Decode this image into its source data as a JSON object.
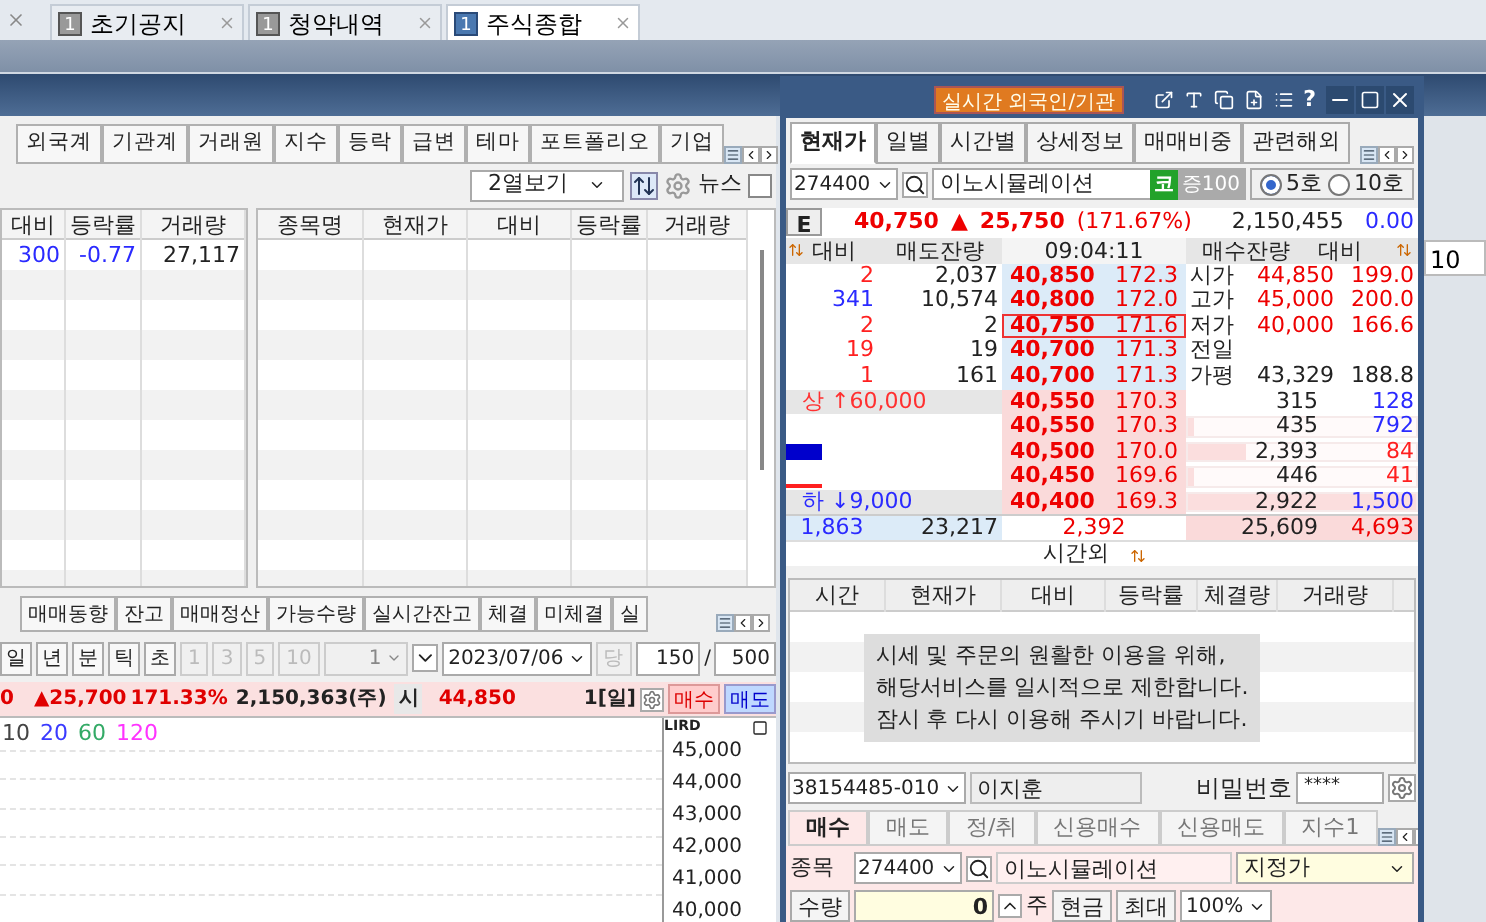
{
  "top_tabs": [
    {
      "badge": "1",
      "label": "초기공지",
      "selected": false
    },
    {
      "badge": "1",
      "label": "청약내역",
      "selected": false
    },
    {
      "badge": "1",
      "label": "주식종합",
      "selected": true
    }
  ],
  "left_window": {
    "tabs": [
      "외국계",
      "기관계",
      "거래원",
      "지수",
      "등락",
      "급변",
      "테마",
      "포트폴리오",
      "기업"
    ],
    "view_select": "2열보기",
    "news_label": "뉴스",
    "news_checked": false,
    "table_a": {
      "columns": [
        "대비",
        "등락률",
        "거래량"
      ],
      "rows": [
        {
          "cells": [
            "300",
            "-0.77",
            "27,117"
          ],
          "color": "#2a2aff"
        }
      ]
    },
    "table_b": {
      "columns": [
        "종목명",
        "현재가",
        "대비",
        "등락률",
        "거래량"
      ]
    },
    "bottom_tabs": [
      "매매동향",
      "잔고",
      "매매정산",
      "가능수량",
      "실시간잔고",
      "체결",
      "미체결",
      "실"
    ],
    "periods": [
      "일",
      "년",
      "분",
      "틱",
      "초"
    ],
    "intervals": [
      {
        "label": "1",
        "disabled": true
      },
      {
        "label": "3",
        "disabled": true
      },
      {
        "label": "5",
        "disabled": true
      },
      {
        "label": "10",
        "disabled": true
      }
    ],
    "count_select": "1",
    "date": "2023/07/06",
    "today_button": "당",
    "count": "150",
    "separator": "/",
    "max_count": "500",
    "quote": {
      "price": "0",
      "change": "▲25,700",
      "rate": "171.33%",
      "volume": "2,150,363(주)",
      "open_label": "시",
      "open": "44,850",
      "period": "1[일]",
      "buy": "매수",
      "sell": "매도"
    },
    "chart": {
      "legend": [
        {
          "label": "10",
          "color": "#444444"
        },
        {
          "label": "20",
          "color": "#3a3aff"
        },
        {
          "label": "60",
          "color": "#33aa66"
        },
        {
          "label": "120",
          "color": "#ff33ff"
        }
      ],
      "axis_tag": "LIRD",
      "yticks": [
        "45,000",
        "44,000",
        "43,000",
        "42,000",
        "41,000",
        "40,000"
      ]
    }
  },
  "quote_window": {
    "title_button": "실시간 외국인/기관",
    "help": "?",
    "tabs": [
      {
        "label": "현재가",
        "selected": true
      },
      {
        "label": "일별",
        "selected": false
      },
      {
        "label": "시간별",
        "selected": false
      },
      {
        "label": "상세정보",
        "selected": false
      },
      {
        "label": "매매비중",
        "selected": false
      },
      {
        "label": "관련해외",
        "selected": false
      }
    ],
    "code": "274400",
    "name": "이노시뮬레이션",
    "market": "코",
    "margin": "증100",
    "depth_options": [
      {
        "label": "5호",
        "selected": true
      },
      {
        "label": "10호",
        "selected": false
      }
    ],
    "summary": {
      "tag": "E",
      "price": "40,750",
      "arrow": "▲",
      "change": "25,750",
      "rate": "(171.67%)",
      "volume": "2,150,455",
      "value": "0.00"
    },
    "book_header": [
      "대비",
      "매도잔량",
      "09:04:11",
      "매수잔량",
      "대비"
    ],
    "asks": [
      {
        "diff": "2",
        "color": "#ff2020",
        "qty": "2,037",
        "price": "40,850",
        "rate": "172.3",
        "current": false,
        "label": "시가",
        "value": "44,850",
        "value_rate": "199.0"
      },
      {
        "diff": "341",
        "color": "#2a2aff",
        "qty": "10,574",
        "price": "40,800",
        "rate": "172.0",
        "current": false,
        "label": "고가",
        "value": "45,000",
        "value_rate": "200.0"
      },
      {
        "diff": "2",
        "color": "#ff2020",
        "qty": "2",
        "price": "40,750",
        "rate": "171.6",
        "current": true,
        "label": "저가",
        "value": "40,000",
        "value_rate": "166.6"
      },
      {
        "diff": "19",
        "color": "#ff2020",
        "qty": "19",
        "price": "40,700",
        "rate": "171.3",
        "current": false,
        "label": "전일"
      },
      {
        "diff": "1",
        "color": "#ff2020",
        "qty": "161",
        "price": "40,700",
        "rate": "171.3",
        "current": false,
        "label": "가평",
        "value": "43,329",
        "value_rate": "188.8"
      }
    ],
    "bids": [
      {
        "kind": "limit_up",
        "info": "상 ↑60,000",
        "price": "40,550",
        "rate": "170.3",
        "qty": "315",
        "diff": "128",
        "color": "#2a2aff"
      },
      {
        "kind": "empty",
        "price": "40,550",
        "rate": "170.3",
        "qty": "435",
        "diff": "792",
        "color": "#2a2aff",
        "level": 0.03
      },
      {
        "kind": "bar",
        "price": "40,500",
        "rate": "170.0",
        "qty": "2,393",
        "diff": "84",
        "color": "#ff2020",
        "level": 0.25
      },
      {
        "kind": "line",
        "price": "40,450",
        "rate": "169.6",
        "qty": "446",
        "diff": "41",
        "color": "#ff2020",
        "level": 0.03
      },
      {
        "kind": "limit_down",
        "info": "하 ↓9,000",
        "price": "40,400",
        "rate": "169.3",
        "qty": "2,922",
        "diff": "1,500",
        "color": "#2a2aff",
        "level": 1
      }
    ],
    "totals": {
      "ask_diff": "1,863",
      "ask_qty": "23,217",
      "net": "2,392",
      "bid_qty": "25,609",
      "bid_diff": "4,693"
    },
    "after_hours": "시간외",
    "tick_columns": [
      "시간",
      "현재가",
      "대비",
      "등락률",
      "체결량",
      "거래량"
    ],
    "notice": "시세 및 주문의 원활한 이용을 위해,\n해당서비스를 일시적으로 제한합니다.\n잠시 후 다시 이용해 주시기 바랍니다.",
    "account": {
      "number": "38154485-010",
      "owner": "이지훈",
      "password_label": "비밀번호",
      "password": "****"
    },
    "order_tabs": [
      {
        "label": "매수",
        "selected": true
      },
      {
        "label": "매도",
        "selected": false
      },
      {
        "label": "정/취",
        "selected": false
      },
      {
        "label": "신용매수",
        "selected": false
      },
      {
        "label": "신용매도",
        "selected": false
      },
      {
        "label": "지수1",
        "selected": false
      }
    ],
    "order": {
      "code_label": "종목",
      "code": "274400",
      "name": "이노시뮬레이션",
      "price_type": "지정가",
      "qty_label": "수량",
      "qty": "0",
      "unit": "주",
      "cash": "현금",
      "max": "최대",
      "ratio": "100%"
    }
  },
  "side_panel": {
    "value": "10"
  }
}
